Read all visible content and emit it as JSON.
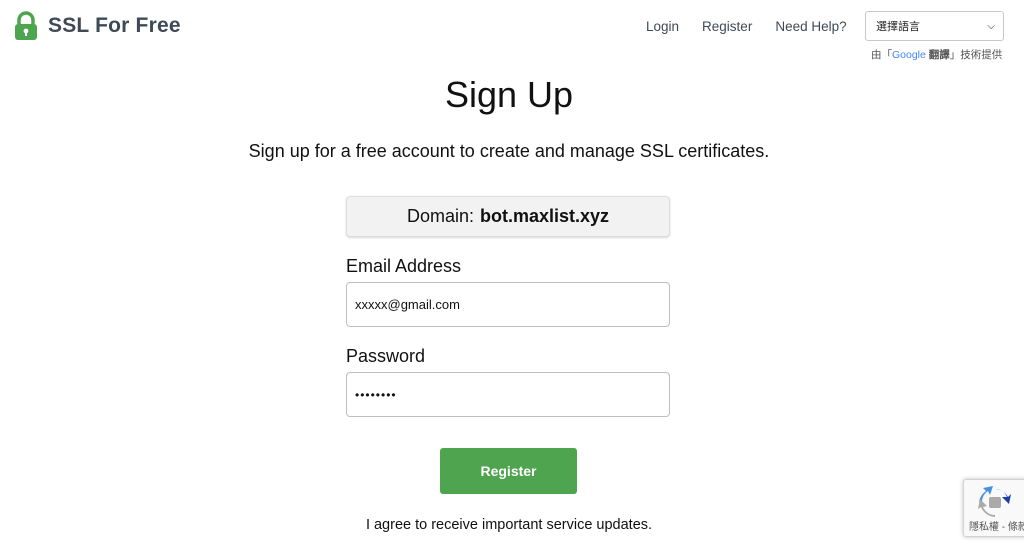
{
  "header": {
    "brand": "SSL For Free",
    "nav": {
      "login": "Login",
      "register": "Register",
      "help": "Need Help?"
    },
    "language_select": {
      "value": "選擇語言",
      "icon": "chevron-down-icon"
    },
    "powered_by": {
      "prefix": "由「",
      "google": "Google",
      "translate": "翻譯",
      "suffix": "」技術提供"
    }
  },
  "main": {
    "title": "Sign Up",
    "subtitle": "Sign up for a free account to create and manage SSL certificates.",
    "domain_label": "Domain:",
    "domain_value": "bot.maxlist.xyz",
    "email_label": "Email Address",
    "email_value": "xxxxx@gmail.com",
    "password_label": "Password",
    "password_value": "••••••••",
    "register_button": "Register",
    "agree_text": "I agree to receive important service updates."
  },
  "recaptcha": {
    "text": "隱私權 - 條款",
    "icon": "recaptcha-icon"
  },
  "colors": {
    "brand_green": "#4fa54f",
    "text_dark": "#3f4a57"
  }
}
